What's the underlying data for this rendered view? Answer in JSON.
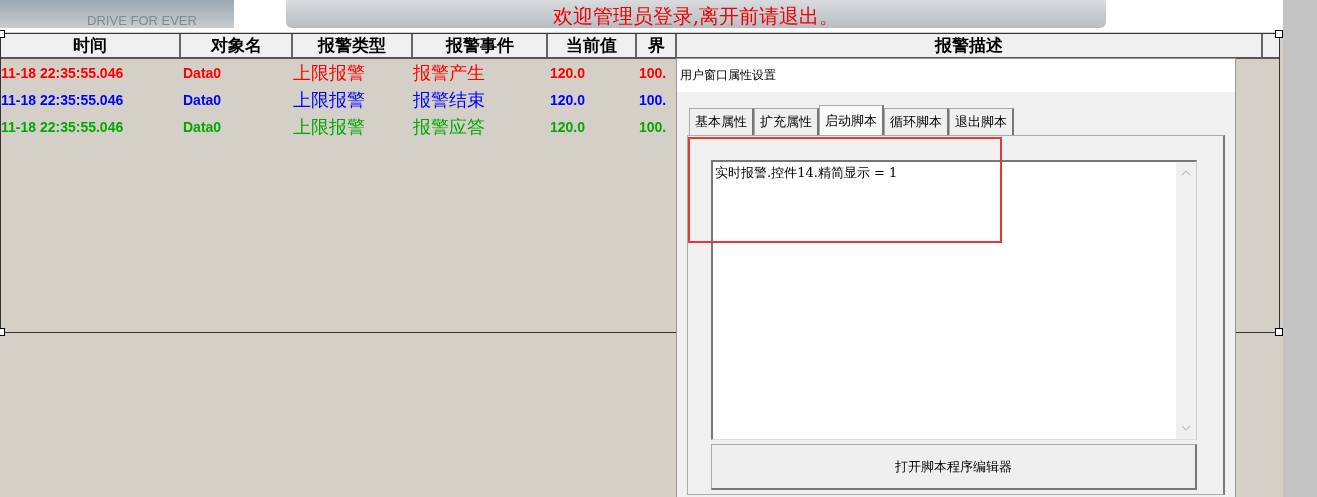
{
  "banner": {
    "logo_tagline": "DRIVE FOR EVER",
    "message": "欢迎管理员登录,离开前请退出。"
  },
  "alarm_table": {
    "columns": [
      "时间",
      "对象名",
      "报警类型",
      "报警事件",
      "当前值",
      "界",
      "报警描述"
    ],
    "rows": [
      {
        "color": "#ff0000",
        "cells": [
          "11-18 22:35:55.046",
          "Data0",
          "上限报警",
          "报警产生",
          "120.0",
          "100."
        ]
      },
      {
        "color": "#0000ff",
        "cells": [
          "11-18 22:35:55.046",
          "Data0",
          "上限报警",
          "报警结束",
          "120.0",
          "100."
        ]
      },
      {
        "color": "#00a800",
        "cells": [
          "11-18 22:35:55.046",
          "Data0",
          "上限报警",
          "报警应答",
          "120.0",
          "100."
        ]
      }
    ]
  },
  "dialog": {
    "title": "用户窗口属性设置",
    "tabs": [
      {
        "label": "基本属性",
        "selected": false
      },
      {
        "label": "扩充属性",
        "selected": false
      },
      {
        "label": "启动脚本",
        "selected": true
      },
      {
        "label": "循环脚本",
        "selected": false
      },
      {
        "label": "退出脚本",
        "selected": false
      }
    ],
    "script_value": "实时报警.控件14.精简显示 = 1",
    "open_editor_button": "打开脚本程序编辑器"
  }
}
